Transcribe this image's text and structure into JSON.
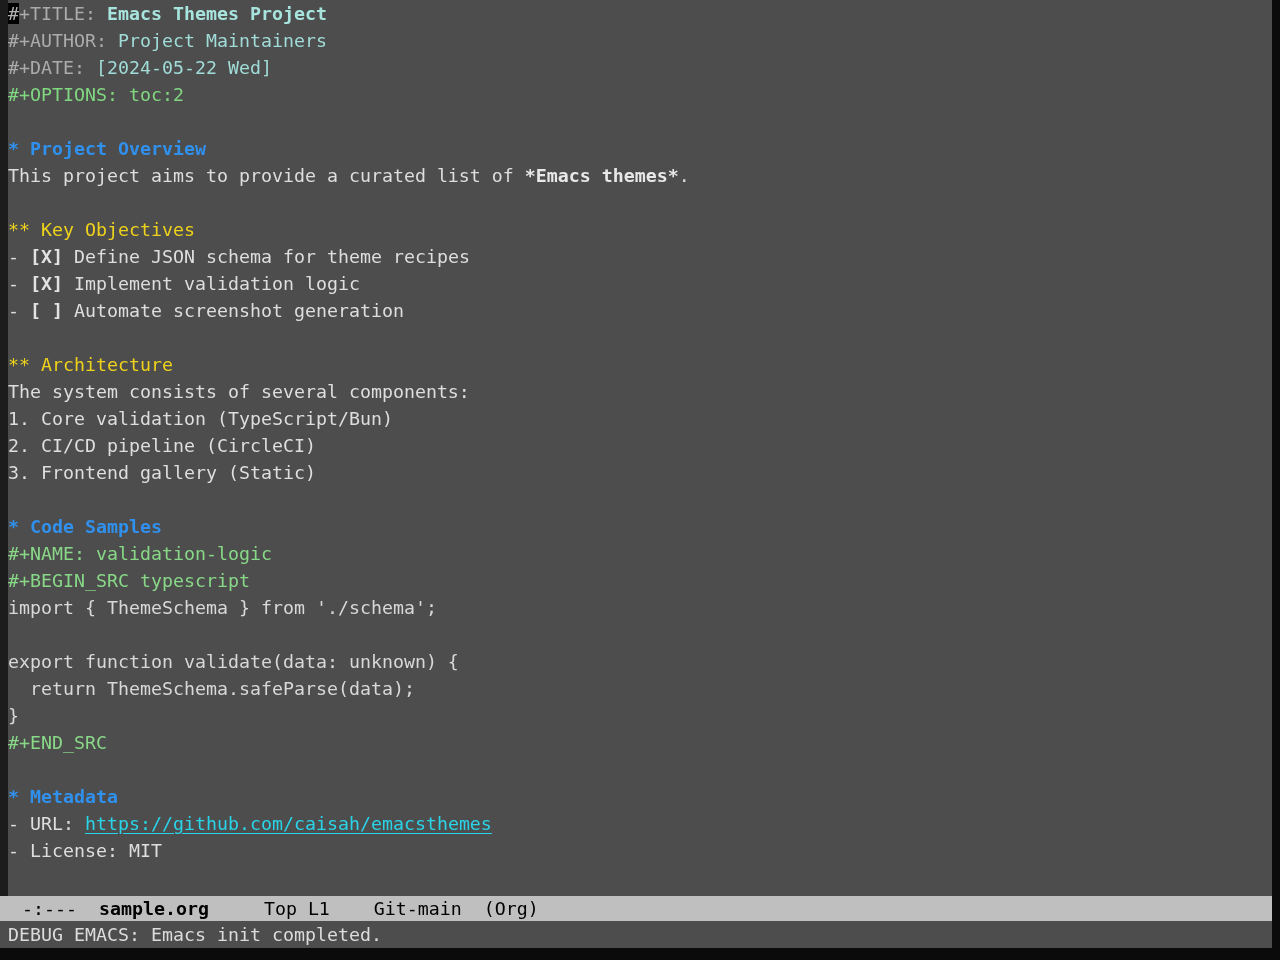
{
  "buffer": {
    "lines": [
      {
        "kind": "keyword",
        "segments": [
          {
            "kind": "cursor",
            "text": "#"
          },
          {
            "kind": "keyword",
            "text": "+TITLE: "
          },
          {
            "kind": "title",
            "text": "Emacs Themes Project"
          }
        ]
      },
      {
        "kind": "keyword",
        "segments": [
          {
            "kind": "keyword",
            "text": "#+AUTHOR: "
          },
          {
            "kind": "info",
            "text": "Project Maintainers"
          }
        ]
      },
      {
        "kind": "keyword",
        "segments": [
          {
            "kind": "keyword",
            "text": "#+DATE: "
          },
          {
            "kind": "info",
            "text": "[2024-05-22 Wed]"
          }
        ]
      },
      {
        "kind": "keyword",
        "segments": [
          {
            "kind": "option",
            "text": "#+OPTIONS: toc:2"
          }
        ]
      },
      {
        "kind": "blank"
      },
      {
        "kind": "heading",
        "segments": [
          {
            "kind": "heading-1",
            "text": "* Project Overview"
          }
        ]
      },
      {
        "kind": "text",
        "segments": [
          {
            "kind": "text",
            "text": "This project aims to provide a curated list of "
          },
          {
            "kind": "bold",
            "text": "*Emacs themes*"
          },
          {
            "kind": "text",
            "text": "."
          }
        ]
      },
      {
        "kind": "blank"
      },
      {
        "kind": "heading",
        "segments": [
          {
            "kind": "heading-2",
            "text": "** Key Objectives"
          }
        ]
      },
      {
        "kind": "list-item",
        "segments": [
          {
            "kind": "text",
            "text": "- "
          },
          {
            "kind": "checkbox",
            "text": "[X]"
          },
          {
            "kind": "text",
            "text": " Define JSON schema for theme recipes"
          }
        ]
      },
      {
        "kind": "list-item",
        "segments": [
          {
            "kind": "text",
            "text": "- "
          },
          {
            "kind": "checkbox",
            "text": "[X]"
          },
          {
            "kind": "text",
            "text": " Implement validation logic"
          }
        ]
      },
      {
        "kind": "list-item",
        "segments": [
          {
            "kind": "text",
            "text": "- "
          },
          {
            "kind": "checkbox",
            "text": "[ ]"
          },
          {
            "kind": "text",
            "text": " Automate screenshot generation"
          }
        ]
      },
      {
        "kind": "blank"
      },
      {
        "kind": "heading",
        "segments": [
          {
            "kind": "heading-2",
            "text": "** Architecture"
          }
        ]
      },
      {
        "kind": "text",
        "segments": [
          {
            "kind": "text",
            "text": "The system consists of several components:"
          }
        ]
      },
      {
        "kind": "list-item",
        "segments": [
          {
            "kind": "text",
            "text": "1. Core validation (TypeScript/Bun)"
          }
        ]
      },
      {
        "kind": "list-item",
        "segments": [
          {
            "kind": "text",
            "text": "2. CI/CD pipeline (CircleCI)"
          }
        ]
      },
      {
        "kind": "list-item",
        "segments": [
          {
            "kind": "text",
            "text": "3. Frontend gallery (Static)"
          }
        ]
      },
      {
        "kind": "blank"
      },
      {
        "kind": "heading",
        "segments": [
          {
            "kind": "heading-1",
            "text": "* Code Samples"
          }
        ]
      },
      {
        "kind": "keyword",
        "segments": [
          {
            "kind": "block",
            "text": "#+NAME: validation-logic"
          }
        ]
      },
      {
        "kind": "keyword",
        "segments": [
          {
            "kind": "block",
            "text": "#+BEGIN_SRC typescript"
          }
        ]
      },
      {
        "kind": "code",
        "segments": [
          {
            "kind": "code",
            "text": "import { ThemeSchema } from './schema';"
          }
        ]
      },
      {
        "kind": "blank"
      },
      {
        "kind": "code",
        "segments": [
          {
            "kind": "code",
            "text": "export function validate(data: unknown) {"
          }
        ]
      },
      {
        "kind": "code",
        "segments": [
          {
            "kind": "code",
            "text": "  return ThemeSchema.safeParse(data);"
          }
        ]
      },
      {
        "kind": "code",
        "segments": [
          {
            "kind": "code",
            "text": "}"
          }
        ]
      },
      {
        "kind": "keyword",
        "segments": [
          {
            "kind": "block",
            "text": "#+END_SRC"
          }
        ]
      },
      {
        "kind": "blank"
      },
      {
        "kind": "heading",
        "segments": [
          {
            "kind": "heading-1",
            "text": "* Metadata"
          }
        ]
      },
      {
        "kind": "list-item",
        "segments": [
          {
            "kind": "text",
            "text": "- URL: "
          },
          {
            "kind": "link",
            "text": "https://github.com/caisah/emacsthemes"
          }
        ]
      },
      {
        "kind": "list-item",
        "segments": [
          {
            "kind": "text",
            "text": "- License: MIT"
          }
        ]
      }
    ]
  },
  "mode_line": [
    {
      "kind": "status",
      "text": "-:---"
    },
    {
      "kind": "buffer-name",
      "text": "sample.org"
    },
    {
      "kind": "position",
      "text": "Top L1"
    },
    {
      "kind": "vc-branch",
      "text": "Git-main"
    },
    {
      "kind": "major-mode",
      "text": "(Org)"
    }
  ],
  "echo_area": {
    "message": "DEBUG EMACS: Emacs init completed."
  }
}
